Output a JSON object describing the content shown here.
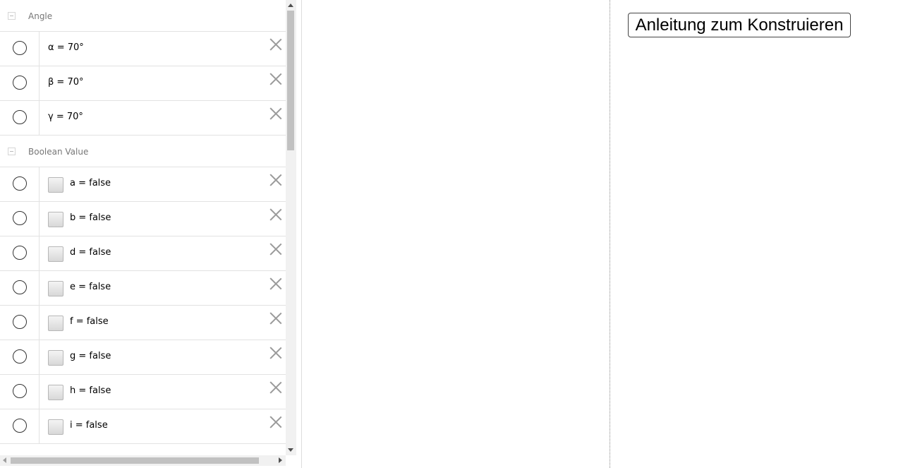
{
  "algebra": {
    "groups": [
      {
        "label": "Angle",
        "items": [
          {
            "expr": "α = 70°"
          },
          {
            "expr": "β = 70°"
          },
          {
            "expr": "γ = 70°"
          }
        ]
      },
      {
        "label": "Boolean Value",
        "items": [
          {
            "expr": "a = false"
          },
          {
            "expr": "b = false"
          },
          {
            "expr": "d = false"
          },
          {
            "expr": "e = false"
          },
          {
            "expr": "f = false"
          },
          {
            "expr": "g = false"
          },
          {
            "expr": "h = false"
          },
          {
            "expr": "i = false"
          }
        ]
      }
    ]
  },
  "graphics2": {
    "construct_button_label": "Anleitung zum Konstruieren"
  }
}
